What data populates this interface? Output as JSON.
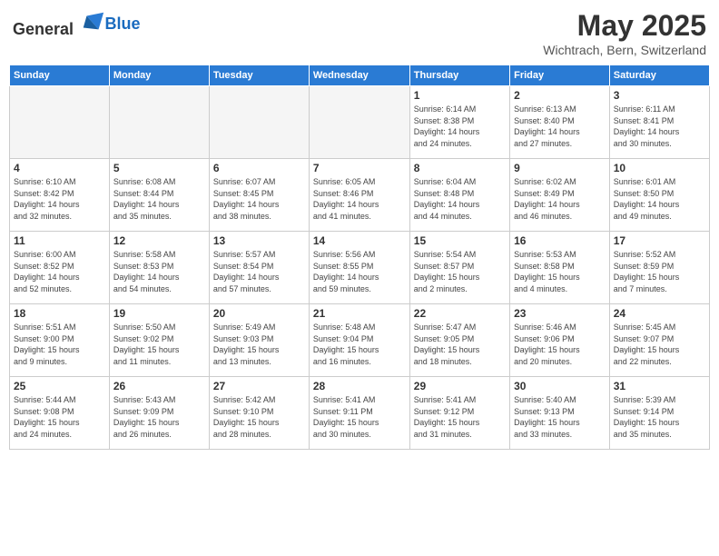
{
  "header": {
    "logo_general": "General",
    "logo_blue": "Blue",
    "month": "May 2025",
    "location": "Wichtrach, Bern, Switzerland"
  },
  "weekdays": [
    "Sunday",
    "Monday",
    "Tuesday",
    "Wednesday",
    "Thursday",
    "Friday",
    "Saturday"
  ],
  "weeks": [
    [
      {
        "day": "",
        "info": ""
      },
      {
        "day": "",
        "info": ""
      },
      {
        "day": "",
        "info": ""
      },
      {
        "day": "",
        "info": ""
      },
      {
        "day": "1",
        "info": "Sunrise: 6:14 AM\nSunset: 8:38 PM\nDaylight: 14 hours\nand 24 minutes."
      },
      {
        "day": "2",
        "info": "Sunrise: 6:13 AM\nSunset: 8:40 PM\nDaylight: 14 hours\nand 27 minutes."
      },
      {
        "day": "3",
        "info": "Sunrise: 6:11 AM\nSunset: 8:41 PM\nDaylight: 14 hours\nand 30 minutes."
      }
    ],
    [
      {
        "day": "4",
        "info": "Sunrise: 6:10 AM\nSunset: 8:42 PM\nDaylight: 14 hours\nand 32 minutes."
      },
      {
        "day": "5",
        "info": "Sunrise: 6:08 AM\nSunset: 8:44 PM\nDaylight: 14 hours\nand 35 minutes."
      },
      {
        "day": "6",
        "info": "Sunrise: 6:07 AM\nSunset: 8:45 PM\nDaylight: 14 hours\nand 38 minutes."
      },
      {
        "day": "7",
        "info": "Sunrise: 6:05 AM\nSunset: 8:46 PM\nDaylight: 14 hours\nand 41 minutes."
      },
      {
        "day": "8",
        "info": "Sunrise: 6:04 AM\nSunset: 8:48 PM\nDaylight: 14 hours\nand 44 minutes."
      },
      {
        "day": "9",
        "info": "Sunrise: 6:02 AM\nSunset: 8:49 PM\nDaylight: 14 hours\nand 46 minutes."
      },
      {
        "day": "10",
        "info": "Sunrise: 6:01 AM\nSunset: 8:50 PM\nDaylight: 14 hours\nand 49 minutes."
      }
    ],
    [
      {
        "day": "11",
        "info": "Sunrise: 6:00 AM\nSunset: 8:52 PM\nDaylight: 14 hours\nand 52 minutes."
      },
      {
        "day": "12",
        "info": "Sunrise: 5:58 AM\nSunset: 8:53 PM\nDaylight: 14 hours\nand 54 minutes."
      },
      {
        "day": "13",
        "info": "Sunrise: 5:57 AM\nSunset: 8:54 PM\nDaylight: 14 hours\nand 57 minutes."
      },
      {
        "day": "14",
        "info": "Sunrise: 5:56 AM\nSunset: 8:55 PM\nDaylight: 14 hours\nand 59 minutes."
      },
      {
        "day": "15",
        "info": "Sunrise: 5:54 AM\nSunset: 8:57 PM\nDaylight: 15 hours\nand 2 minutes."
      },
      {
        "day": "16",
        "info": "Sunrise: 5:53 AM\nSunset: 8:58 PM\nDaylight: 15 hours\nand 4 minutes."
      },
      {
        "day": "17",
        "info": "Sunrise: 5:52 AM\nSunset: 8:59 PM\nDaylight: 15 hours\nand 7 minutes."
      }
    ],
    [
      {
        "day": "18",
        "info": "Sunrise: 5:51 AM\nSunset: 9:00 PM\nDaylight: 15 hours\nand 9 minutes."
      },
      {
        "day": "19",
        "info": "Sunrise: 5:50 AM\nSunset: 9:02 PM\nDaylight: 15 hours\nand 11 minutes."
      },
      {
        "day": "20",
        "info": "Sunrise: 5:49 AM\nSunset: 9:03 PM\nDaylight: 15 hours\nand 13 minutes."
      },
      {
        "day": "21",
        "info": "Sunrise: 5:48 AM\nSunset: 9:04 PM\nDaylight: 15 hours\nand 16 minutes."
      },
      {
        "day": "22",
        "info": "Sunrise: 5:47 AM\nSunset: 9:05 PM\nDaylight: 15 hours\nand 18 minutes."
      },
      {
        "day": "23",
        "info": "Sunrise: 5:46 AM\nSunset: 9:06 PM\nDaylight: 15 hours\nand 20 minutes."
      },
      {
        "day": "24",
        "info": "Sunrise: 5:45 AM\nSunset: 9:07 PM\nDaylight: 15 hours\nand 22 minutes."
      }
    ],
    [
      {
        "day": "25",
        "info": "Sunrise: 5:44 AM\nSunset: 9:08 PM\nDaylight: 15 hours\nand 24 minutes."
      },
      {
        "day": "26",
        "info": "Sunrise: 5:43 AM\nSunset: 9:09 PM\nDaylight: 15 hours\nand 26 minutes."
      },
      {
        "day": "27",
        "info": "Sunrise: 5:42 AM\nSunset: 9:10 PM\nDaylight: 15 hours\nand 28 minutes."
      },
      {
        "day": "28",
        "info": "Sunrise: 5:41 AM\nSunset: 9:11 PM\nDaylight: 15 hours\nand 30 minutes."
      },
      {
        "day": "29",
        "info": "Sunrise: 5:41 AM\nSunset: 9:12 PM\nDaylight: 15 hours\nand 31 minutes."
      },
      {
        "day": "30",
        "info": "Sunrise: 5:40 AM\nSunset: 9:13 PM\nDaylight: 15 hours\nand 33 minutes."
      },
      {
        "day": "31",
        "info": "Sunrise: 5:39 AM\nSunset: 9:14 PM\nDaylight: 15 hours\nand 35 minutes."
      }
    ]
  ]
}
